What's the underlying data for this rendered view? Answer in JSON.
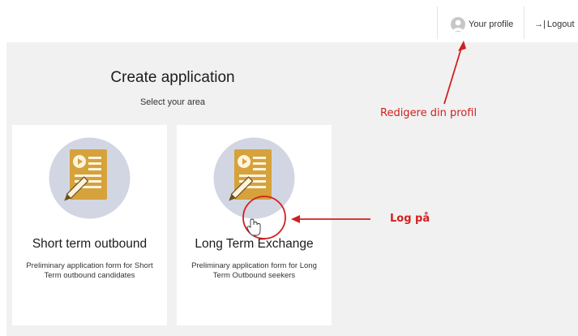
{
  "header": {
    "profile_label": "Your profile",
    "logout_label": "Logout",
    "logout_glyph": "→|"
  },
  "main": {
    "title": "Create application",
    "subtitle": "Select your area"
  },
  "cards": [
    {
      "title": "Short term outbound",
      "description": "Preliminary application form for Short Term outbound candidates",
      "icon": "document-pen-icon"
    },
    {
      "title": "Long Term Exchange",
      "description": "Preliminary application form for Long Term Outbound seekers",
      "icon": "document-pen-icon"
    }
  ],
  "annotations": {
    "profile_note": "Redigere din profil",
    "login_note": "Log på",
    "color": "#d22020"
  },
  "colors": {
    "background": "#f1f1f1",
    "icon_circle": "#d1d6e2",
    "document": "#d5a23c",
    "document_lines": "#fdf3dc"
  }
}
